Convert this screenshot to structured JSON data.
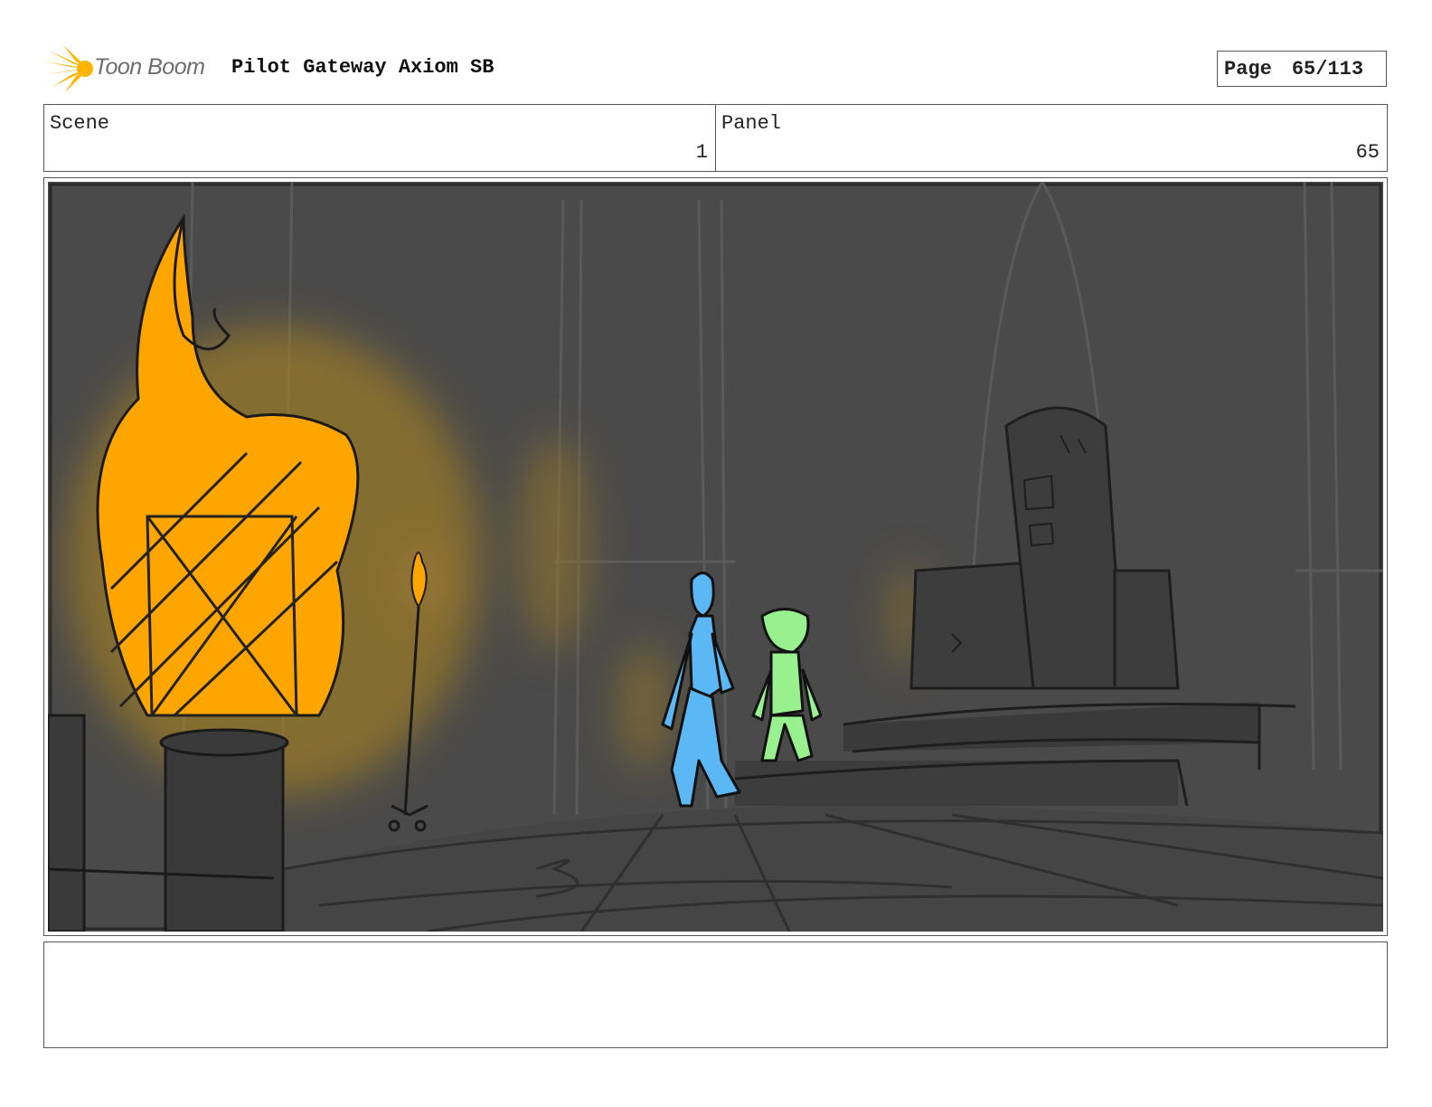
{
  "header": {
    "brand_name": "Toon Boom",
    "title": "Pilot Gateway Axiom SB",
    "page_label": "Page",
    "page_number": "65/113"
  },
  "info": {
    "scene_label": "Scene",
    "scene_value": "1",
    "panel_label": "Panel",
    "panel_value": "65"
  },
  "notes": {
    "text": ""
  },
  "colors": {
    "brand": "#FFB400",
    "frame_bg": "#4a4a4a",
    "flame": "#FFA500",
    "character_blue": "#5BB8F5",
    "character_green": "#98F08F"
  },
  "icons": [
    "toon-boom-logo-icon"
  ]
}
